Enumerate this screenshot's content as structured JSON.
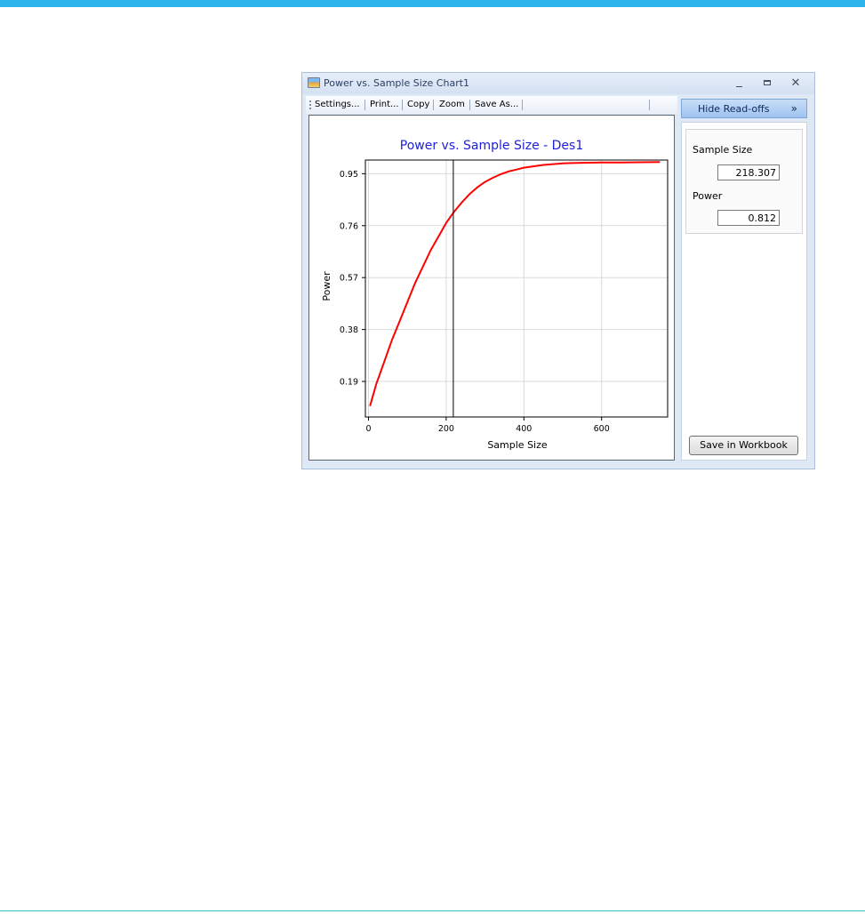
{
  "window": {
    "title": "Power vs. Sample Size Chart1",
    "controls": {
      "minimize": "_",
      "maximize": "▭",
      "close": "✕"
    }
  },
  "toolbar": {
    "settings": "Settings...",
    "print": "Print...",
    "copy": "Copy",
    "zoom": "Zoom",
    "save_as": "Save As..."
  },
  "side_panel": {
    "toggle_label": "Hide Read-offs",
    "toggle_chevron": "»",
    "sample_size_label": "Sample Size",
    "sample_size_value": "218.307",
    "power_label": "Power",
    "power_value": "0.812",
    "save_button": "Save in Workbook"
  },
  "colors": {
    "title": "#1f1fd6",
    "curve": "#ff0000",
    "readoff_line": "#000000",
    "accent_bar": "#2eb4ec"
  },
  "chart_data": {
    "type": "line",
    "title": "Power vs. Sample Size - Des1",
    "xlabel": "Sample Size",
    "ylabel": "Power",
    "xlim": [
      -8,
      770
    ],
    "ylim": [
      0.06,
      1.0
    ],
    "x_ticks": [
      0,
      200,
      400,
      600
    ],
    "x_tick_labels": [
      "0",
      "200",
      "400",
      "600"
    ],
    "y_ticks": [
      0.19,
      0.38,
      0.57,
      0.76,
      0.95
    ],
    "y_tick_labels": [
      "0.19",
      "0.38",
      "0.57",
      "0.76",
      "0.95"
    ],
    "grid": true,
    "series": [
      {
        "x": [
          4,
          20,
          40,
          60,
          80,
          100,
          120,
          140,
          160,
          180,
          200,
          220,
          240,
          260,
          280,
          300,
          320,
          340,
          360,
          380,
          400,
          450,
          500,
          550,
          600,
          650,
          700,
          750
        ],
        "y": [
          0.1,
          0.18,
          0.26,
          0.34,
          0.41,
          0.48,
          0.55,
          0.61,
          0.67,
          0.72,
          0.77,
          0.81,
          0.845,
          0.875,
          0.9,
          0.92,
          0.935,
          0.948,
          0.958,
          0.965,
          0.972,
          0.982,
          0.988,
          0.99,
          0.991,
          0.991,
          0.992,
          0.993
        ]
      }
    ],
    "readoff": {
      "x": 218.307,
      "y": 0.812
    }
  }
}
